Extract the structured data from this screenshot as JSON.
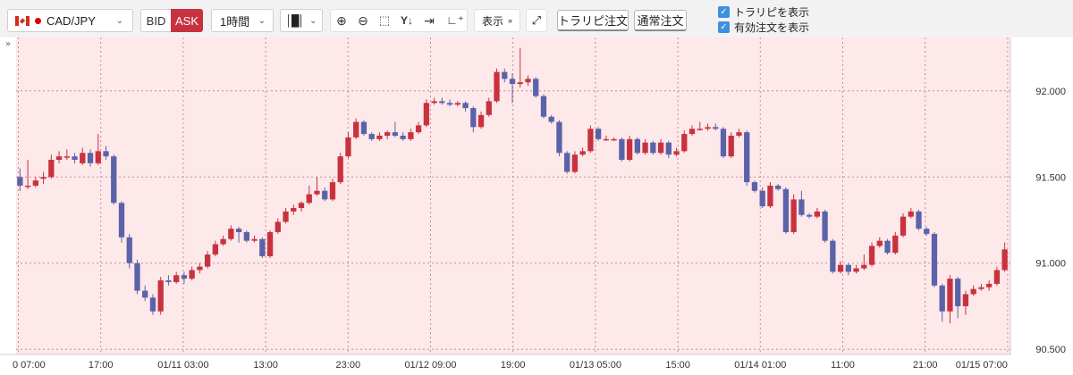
{
  "toolbar": {
    "pair": "CAD/JPY",
    "bid_label": "BID",
    "ask_label": "ASK",
    "timeframe": "1時間",
    "display_label": "表示",
    "trail_order_label": "トラリピ注文",
    "normal_order_label": "通常注文",
    "show_trail_label": "トラリピを表示",
    "show_valid_orders_label": "有効注文を表示",
    "show_trail_checked": true,
    "show_valid_orders_checked": true,
    "icons": [
      "canada-flag-icon",
      "status-dot-icon",
      "chevron-down-icon",
      "candlestick-icon",
      "zoom-in-icon",
      "zoom-out-icon",
      "fit-icon",
      "y-scale-icon",
      "jump-to-end-icon",
      "indicator-add-icon",
      "double-chevron-down-icon",
      "expand-icon",
      "checkbox-icon"
    ],
    "colors": {
      "ask_active": "#c8323e",
      "checkbox": "#3d8fe0"
    }
  },
  "chart_data": {
    "type": "candlestick",
    "instrument": "CAD/JPY",
    "interval": "1時間",
    "side": "ASK",
    "y_ticks": [
      "92.000",
      "91.500",
      "91.000",
      "90.500"
    ],
    "ylim": [
      90.47,
      92.31
    ],
    "x_labels": [
      "0 07:00",
      "17:00",
      "01/11 03:00",
      "13:00",
      "23:00",
      "01/12 09:00",
      "19:00",
      "01/13 05:00",
      "15:00",
      "01/14 01:00",
      "11:00",
      "21:00",
      "01/15 07:00"
    ],
    "grid": true,
    "background_color": "#fde8ea",
    "up_color": "#c8323e",
    "down_color": "#5b63a8",
    "candles": [
      [
        91.5,
        91.45,
        91.55,
        91.42
      ],
      [
        91.45,
        91.45,
        91.6,
        91.43
      ],
      [
        91.45,
        91.48,
        91.5,
        91.44
      ],
      [
        91.49,
        91.5,
        91.53,
        91.46
      ],
      [
        91.5,
        91.6,
        91.63,
        91.49
      ],
      [
        91.6,
        91.62,
        91.65,
        91.58
      ],
      [
        91.62,
        91.62,
        91.66,
        91.6
      ],
      [
        91.62,
        91.6,
        91.64,
        91.58
      ],
      [
        91.58,
        91.64,
        91.67,
        91.57
      ],
      [
        91.64,
        91.58,
        91.66,
        91.56
      ],
      [
        91.58,
        91.65,
        91.75,
        91.57
      ],
      [
        91.65,
        91.62,
        91.68,
        91.6
      ],
      [
        91.62,
        91.35,
        91.63,
        91.34
      ],
      [
        91.35,
        91.15,
        91.36,
        91.12
      ],
      [
        91.15,
        91.0,
        91.17,
        90.97
      ],
      [
        91.0,
        90.84,
        91.02,
        90.82
      ],
      [
        90.84,
        90.8,
        90.87,
        90.78
      ],
      [
        90.8,
        90.72,
        90.82,
        90.7
      ],
      [
        90.72,
        90.9,
        90.92,
        90.7
      ],
      [
        90.9,
        90.89,
        90.93,
        90.87
      ],
      [
        90.89,
        90.93,
        90.95,
        90.88
      ],
      [
        90.93,
        90.91,
        90.95,
        90.88
      ],
      [
        90.91,
        90.96,
        90.98,
        90.9
      ],
      [
        90.96,
        90.98,
        91.0,
        90.94
      ],
      [
        90.98,
        91.05,
        91.07,
        90.97
      ],
      [
        91.05,
        91.11,
        91.13,
        91.04
      ],
      [
        91.11,
        91.14,
        91.16,
        91.1
      ],
      [
        91.14,
        91.2,
        91.22,
        91.13
      ],
      [
        91.2,
        91.18,
        91.21,
        91.12
      ],
      [
        91.18,
        91.13,
        91.19,
        91.12
      ],
      [
        91.13,
        91.14,
        91.16,
        91.12
      ],
      [
        91.14,
        91.04,
        91.15,
        91.03
      ],
      [
        91.04,
        91.18,
        91.19,
        91.03
      ],
      [
        91.18,
        91.24,
        91.26,
        91.17
      ],
      [
        91.24,
        91.3,
        91.32,
        91.23
      ],
      [
        91.3,
        91.32,
        91.34,
        91.28
      ],
      [
        91.32,
        91.35,
        91.36,
        91.3
      ],
      [
        91.35,
        91.4,
        91.45,
        91.34
      ],
      [
        91.4,
        91.42,
        91.5,
        91.39
      ],
      [
        91.42,
        91.37,
        91.44,
        91.36
      ],
      [
        91.37,
        91.47,
        91.49,
        91.36
      ],
      [
        91.47,
        91.62,
        91.64,
        91.46
      ],
      [
        91.62,
        91.73,
        91.76,
        91.61
      ],
      [
        91.73,
        91.82,
        91.84,
        91.72
      ],
      [
        91.82,
        91.75,
        91.83,
        91.74
      ],
      [
        91.75,
        91.72,
        91.76,
        91.71
      ],
      [
        91.72,
        91.74,
        91.76,
        91.71
      ],
      [
        91.74,
        91.76,
        91.77,
        91.72
      ],
      [
        91.76,
        91.74,
        91.82,
        91.73
      ],
      [
        91.74,
        91.72,
        91.76,
        91.71
      ],
      [
        91.72,
        91.76,
        91.78,
        91.71
      ],
      [
        91.76,
        91.8,
        91.82,
        91.75
      ],
      [
        91.8,
        91.93,
        91.95,
        91.79
      ],
      [
        91.93,
        91.94,
        91.96,
        91.92
      ],
      [
        91.94,
        91.93,
        91.96,
        91.92
      ],
      [
        91.93,
        91.92,
        91.95,
        91.91
      ],
      [
        91.92,
        91.93,
        91.94,
        91.91
      ],
      [
        91.93,
        91.9,
        91.94,
        91.88
      ],
      [
        91.9,
        91.79,
        91.91,
        91.76
      ],
      [
        91.79,
        91.86,
        91.88,
        91.78
      ],
      [
        91.86,
        91.94,
        91.96,
        91.85
      ],
      [
        91.94,
        92.11,
        92.13,
        91.93
      ],
      [
        92.11,
        92.07,
        92.13,
        92.05
      ],
      [
        92.07,
        92.04,
        92.1,
        91.93
      ],
      [
        92.04,
        92.05,
        92.25,
        92.02
      ],
      [
        92.05,
        92.07,
        92.09,
        92.03
      ],
      [
        92.07,
        91.97,
        92.08,
        91.96
      ],
      [
        91.97,
        91.85,
        91.98,
        91.84
      ],
      [
        91.85,
        91.82,
        91.86,
        91.81
      ],
      [
        91.82,
        91.64,
        91.83,
        91.62
      ],
      [
        91.64,
        91.53,
        91.65,
        91.52
      ],
      [
        91.53,
        91.63,
        91.65,
        91.52
      ],
      [
        91.63,
        91.65,
        91.67,
        91.62
      ],
      [
        91.65,
        91.78,
        91.8,
        91.64
      ],
      [
        91.78,
        91.72,
        91.79,
        91.71
      ],
      [
        91.72,
        91.72,
        91.74,
        91.71
      ],
      [
        91.72,
        91.72,
        91.73,
        91.71
      ],
      [
        91.72,
        91.6,
        91.73,
        91.59
      ],
      [
        91.6,
        91.72,
        91.74,
        91.59
      ],
      [
        91.72,
        91.64,
        91.73,
        91.63
      ],
      [
        91.64,
        91.7,
        91.72,
        91.63
      ],
      [
        91.7,
        91.64,
        91.71,
        91.63
      ],
      [
        91.64,
        91.7,
        91.72,
        91.63
      ],
      [
        91.7,
        91.63,
        91.71,
        91.61
      ],
      [
        91.63,
        91.65,
        91.67,
        91.62
      ],
      [
        91.65,
        91.75,
        91.77,
        91.64
      ],
      [
        91.75,
        91.78,
        91.8,
        91.74
      ],
      [
        91.78,
        91.78,
        91.82,
        91.77
      ],
      [
        91.78,
        91.79,
        91.81,
        91.77
      ],
      [
        91.79,
        91.78,
        91.81,
        91.77
      ],
      [
        91.78,
        91.62,
        91.79,
        91.61
      ],
      [
        91.62,
        91.74,
        91.76,
        91.61
      ],
      [
        91.74,
        91.76,
        91.78,
        91.73
      ],
      [
        91.76,
        91.47,
        91.77,
        91.45
      ],
      [
        91.47,
        91.42,
        91.48,
        91.41
      ],
      [
        91.42,
        91.33,
        91.44,
        91.32
      ],
      [
        91.33,
        91.45,
        91.47,
        91.32
      ],
      [
        91.45,
        91.43,
        91.46,
        91.42
      ],
      [
        91.43,
        91.18,
        91.44,
        91.17
      ],
      [
        91.18,
        91.37,
        91.4,
        91.17
      ],
      [
        91.37,
        91.28,
        91.42,
        91.27
      ],
      [
        91.28,
        91.27,
        91.29,
        91.26
      ],
      [
        91.27,
        91.3,
        91.32,
        91.26
      ],
      [
        91.3,
        91.13,
        91.31,
        91.12
      ],
      [
        91.13,
        90.95,
        91.14,
        90.94
      ],
      [
        90.95,
        90.99,
        91.01,
        90.94
      ],
      [
        90.99,
        90.95,
        91.0,
        90.93
      ],
      [
        90.95,
        90.97,
        90.99,
        90.94
      ],
      [
        90.97,
        90.99,
        91.05,
        90.96
      ],
      [
        90.99,
        91.1,
        91.12,
        90.98
      ],
      [
        91.1,
        91.13,
        91.15,
        91.09
      ],
      [
        91.13,
        91.06,
        91.14,
        91.05
      ],
      [
        91.06,
        91.16,
        91.18,
        91.05
      ],
      [
        91.16,
        91.27,
        91.29,
        91.15
      ],
      [
        91.27,
        91.3,
        91.32,
        91.26
      ],
      [
        91.3,
        91.2,
        91.31,
        91.19
      ],
      [
        91.2,
        91.17,
        91.21,
        91.16
      ],
      [
        91.17,
        90.87,
        91.18,
        90.86
      ],
      [
        90.87,
        90.72,
        90.88,
        90.66
      ],
      [
        90.72,
        90.91,
        90.93,
        90.65
      ],
      [
        90.91,
        90.75,
        90.92,
        90.68
      ],
      [
        90.75,
        90.82,
        90.84,
        90.7
      ],
      [
        90.82,
        90.85,
        90.87,
        90.81
      ],
      [
        90.85,
        90.86,
        90.88,
        90.84
      ],
      [
        90.86,
        90.88,
        90.9,
        90.84
      ],
      [
        90.88,
        90.96,
        90.98,
        90.87
      ],
      [
        90.96,
        91.08,
        91.12,
        90.95
      ]
    ]
  }
}
